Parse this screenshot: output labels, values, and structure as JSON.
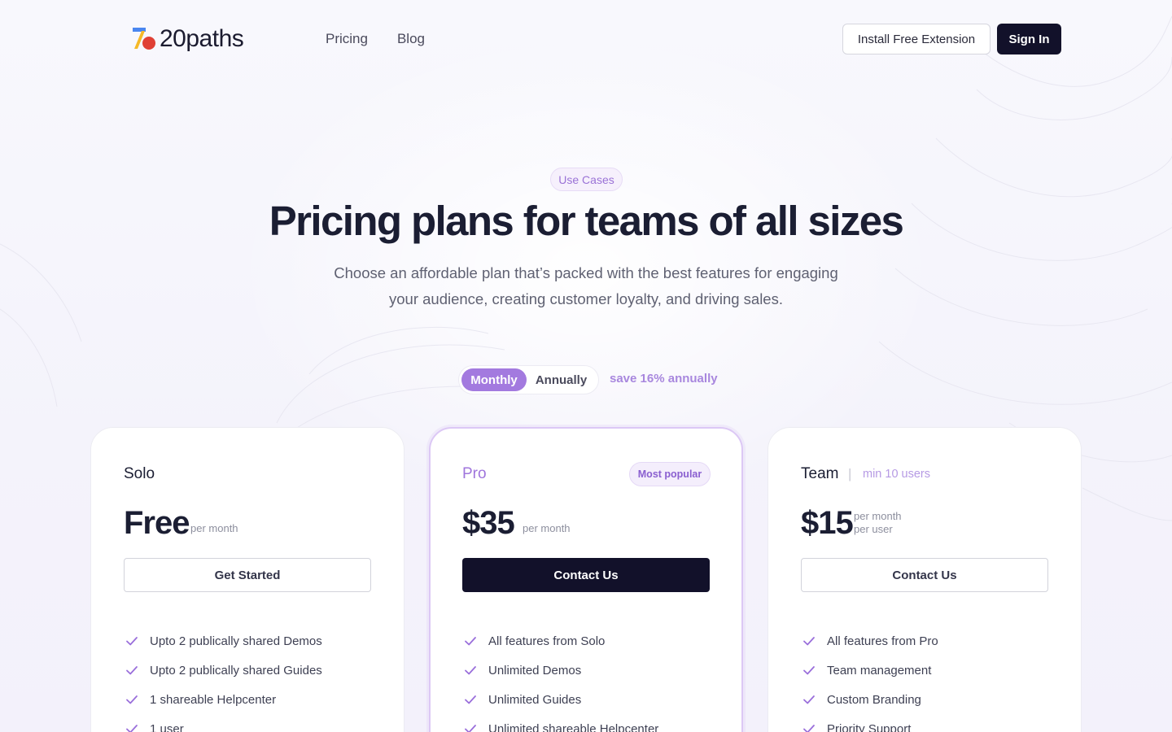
{
  "brand": {
    "name": "20paths"
  },
  "nav": {
    "items": [
      "Pricing",
      "Blog"
    ]
  },
  "header": {
    "install_label": "Install Free Extension",
    "signin_label": "Sign In"
  },
  "hero": {
    "badge": "Use Cases",
    "title": "Pricing plans for teams of all sizes",
    "subtitle": "Choose an affordable plan that’s packed with the best features for engaging your audience, creating customer loyalty, and driving sales."
  },
  "billing": {
    "monthly_label": "Monthly",
    "annually_label": "Annually",
    "selected": "Monthly",
    "save_note": "save 16% annually"
  },
  "colors": {
    "accent": "#a37adf",
    "dark": "#12112a",
    "text": "#1b1e33"
  },
  "plans": [
    {
      "name": "Solo",
      "price": "Free",
      "unit_line1": "per month",
      "cta": "Get Started",
      "features": [
        "Upto 2 publically shared Demos",
        "Upto 2 publically shared Guides",
        "1 shareable Helpcenter",
        "1 user"
      ]
    },
    {
      "name": "Pro",
      "badge": "Most popular",
      "price": "$35",
      "unit_line1": "per month",
      "cta": "Contact Us",
      "features": [
        "All features from Solo",
        "Unlimited Demos",
        "Unlimited Guides",
        "Unlimited shareable Helpcenter"
      ]
    },
    {
      "name": "Team",
      "meta_sep": "|",
      "meta": "min 10 users",
      "price": "$15",
      "unit_line1": "per month",
      "unit_line2": "per user",
      "cta": "Contact Us",
      "features": [
        "All features from Pro",
        "Team management",
        "Custom Branding",
        "Priority Support"
      ]
    }
  ]
}
